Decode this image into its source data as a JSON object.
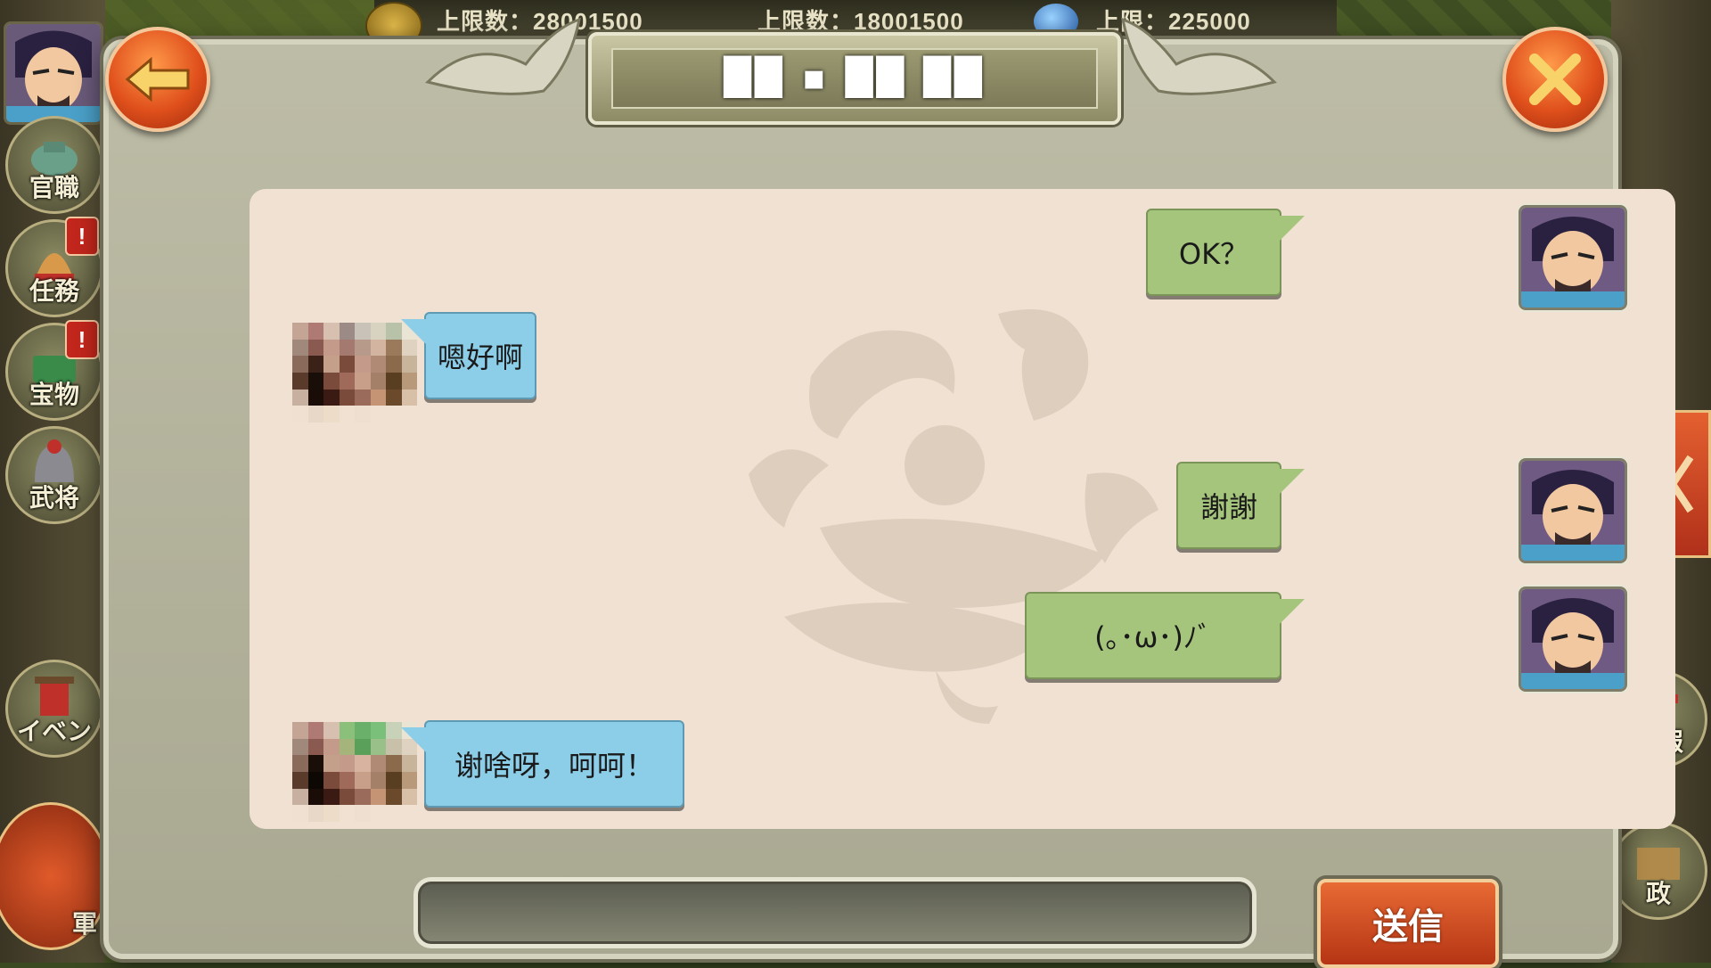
{
  "top_bar": {
    "resource1": "上限数：28001500",
    "resource2": "上限数：18001500",
    "resource3": "上限：225000"
  },
  "left_menu": {
    "items": [
      {
        "label": "官職",
        "icon": "official-rank-icon",
        "badge": ""
      },
      {
        "label": "任務",
        "icon": "quest-bell-icon",
        "badge": "!"
      },
      {
        "label": "宝物",
        "icon": "treasure-cauldron-icon",
        "badge": "!"
      },
      {
        "label": "武将",
        "icon": "general-helmet-icon",
        "badge": ""
      },
      {
        "label": "イベン",
        "icon": "event-gate-icon",
        "badge": ""
      }
    ],
    "army_label": "軍"
  },
  "right_menu": {
    "items": [
      {
        "label": "情報",
        "icon": "info-gate-icon"
      },
      {
        "label": "政",
        "icon": "politics-scroll-icon"
      }
    ]
  },
  "dialog": {
    "title": "██ ▪ ██ ██",
    "back_icon": "back-arrow-icon",
    "close_icon": "close-x-icon"
  },
  "chat": {
    "messages": [
      {
        "side": "mine",
        "text": "OK？"
      },
      {
        "side": "theirs",
        "text": "嗯好啊"
      },
      {
        "side": "mine",
        "text": "謝謝"
      },
      {
        "side": "mine",
        "text": "(｡･ω･)ﾉﾞ"
      },
      {
        "side": "theirs",
        "text": "谢啥呀，呵呵！"
      }
    ]
  },
  "input": {
    "value": "",
    "placeholder": ""
  },
  "send_button": {
    "label": "送信"
  },
  "colors": {
    "mine_bubble": "#a6c57c",
    "theirs_bubble": "#8ccde8",
    "chat_bg": "#f0e1d2",
    "accent": "#e0501c"
  }
}
